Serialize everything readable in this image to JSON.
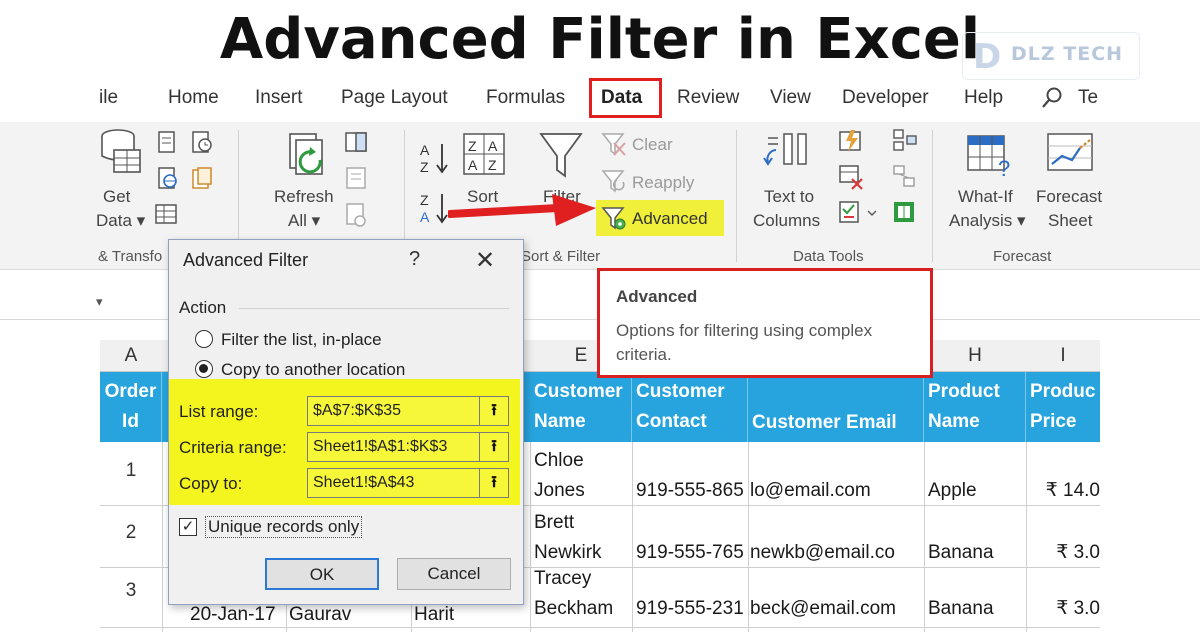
{
  "title": "Advanced Filter in Excel",
  "logo": {
    "text": "DLZ TECH"
  },
  "menu": [
    "ile",
    "Home",
    "Insert",
    "Page Layout",
    "Formulas",
    "Data",
    "Review",
    "View",
    "Developer",
    "Help",
    "Te"
  ],
  "ribbon": {
    "get_data": [
      "Get",
      "Data ▾"
    ],
    "group_get_transform": "& Transfo",
    "refresh_all": [
      "Refresh",
      "All ▾"
    ],
    "sort": "Sort",
    "filter": "Filter",
    "clear": "Clear",
    "reapply": "Reapply",
    "advanced": "Advanced",
    "group_sort_filter": "Sort & Filter",
    "text_to_columns": [
      "Text to",
      "Columns"
    ],
    "group_data_tools": "Data Tools",
    "what_if": [
      "What-If",
      "Analysis ▾"
    ],
    "forecast_sheet": [
      "Forecast",
      "Sheet"
    ],
    "group_forecast": "Forecast"
  },
  "formula_bar": {
    "name_box": "▾"
  },
  "tooltip": {
    "title": "Advanced",
    "body": "Options for filtering using complex criteria."
  },
  "dialog": {
    "title": "Advanced Filter",
    "help": "?",
    "close": "✕",
    "action_label": "Action",
    "option_inplace": "Filter the list, in-place",
    "option_copy": "Copy to another location",
    "list_range_label": "List range:",
    "list_range_value": "$A$7:$K$35",
    "criteria_range_label": "Criteria range:",
    "criteria_range_value": "Sheet1!$A$1:$K$3",
    "copy_to_label": "Copy to:",
    "copy_to_value": "Sheet1!$A$43",
    "unique_label": "Unique records only",
    "ok": "OK",
    "cancel": "Cancel"
  },
  "grid": {
    "col_headers": [
      "A",
      "E",
      "H",
      "I"
    ],
    "header": {
      "order_id": "Order Id",
      "customer_name": "Customer Name",
      "customer_contact": "Customer Contact",
      "customer_email": "Customer Email",
      "product_name": "Product Name",
      "product_price": "Produc Price"
    },
    "rows": [
      {
        "num": "1",
        "name": [
          "Chloe",
          "Jones"
        ],
        "contact": "919-555-865",
        "email": "lo@email.com",
        "product": "Apple",
        "price": "₹ 14.0",
        "date": "",
        "b": "",
        "c": ""
      },
      {
        "num": "2",
        "name": [
          "Brett",
          "Newkirk"
        ],
        "contact": "919-555-765",
        "email": "newkb@email.co",
        "product": "Banana",
        "price": "₹ 3.0",
        "date": "",
        "b": "",
        "c": ""
      },
      {
        "num": "3",
        "name": [
          "Tracey",
          "Beckham"
        ],
        "contact": "919-555-231",
        "email": "beck@email.com",
        "product": "Banana",
        "price": "₹ 3.0",
        "date": "20-Jan-17",
        "b": "Gaurav",
        "c": "Harit"
      }
    ]
  },
  "colors": {
    "accent_red": "#e02020",
    "highlight_yellow": "#f4f41e",
    "header_blue": "#27a4de"
  }
}
